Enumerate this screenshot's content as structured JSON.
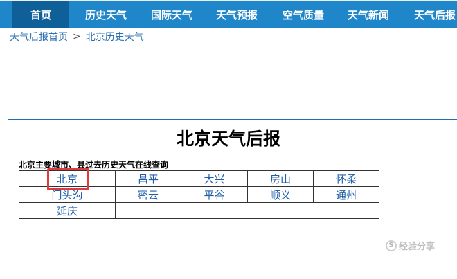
{
  "nav": {
    "items": [
      "首页",
      "历史天气",
      "国际天气",
      "天气预报",
      "空气质量",
      "天气新闻",
      "天气后报"
    ],
    "active_index": 0
  },
  "breadcrumb": {
    "home": "天气后报首页",
    "separator": ">",
    "current": "北京历史天气"
  },
  "main": {
    "title": "北京天气后报",
    "subtitle": "北京主要城市、县过去历史天气在线查询",
    "cities": [
      [
        "北京",
        "昌平",
        "大兴",
        "房山",
        "怀柔"
      ],
      [
        "门头沟",
        "密云",
        "平谷",
        "顺义",
        "通州"
      ],
      [
        "延庆"
      ]
    ],
    "highlighted_city": "北京"
  },
  "watermark": {
    "glyph": "S",
    "text": "经验分享"
  },
  "colors": {
    "nav_bg": "#1f86c9",
    "nav_active": "#0f5f99",
    "link": "#1f5fa8",
    "highlight": "#e0393e"
  }
}
